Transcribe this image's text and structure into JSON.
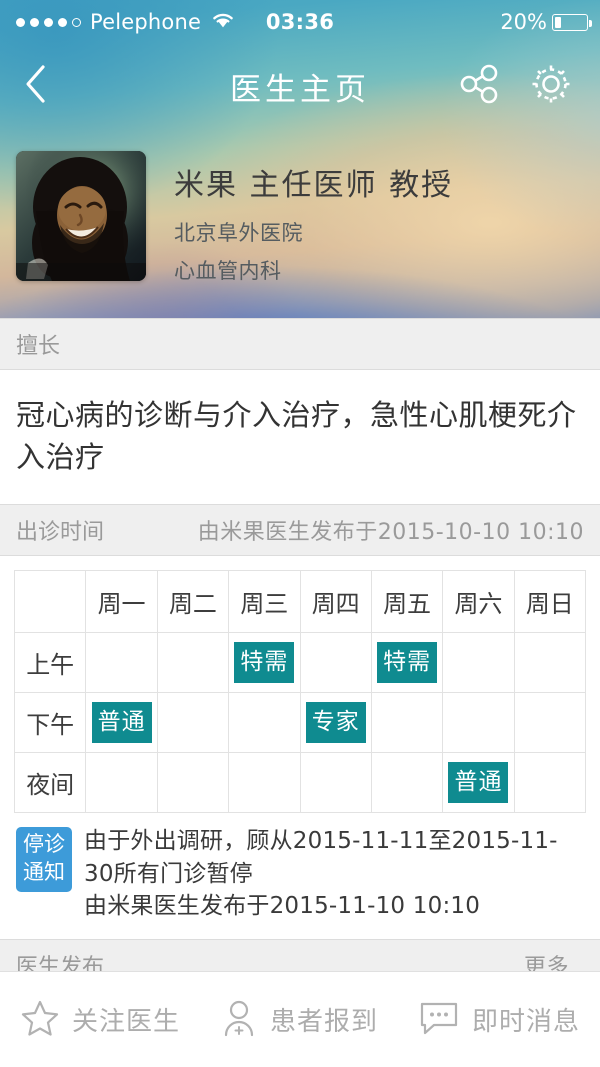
{
  "status_bar": {
    "signal_dots_filled": 4,
    "signal_dots_total": 5,
    "carrier": "Pelephone",
    "wifi_icon": "wifi-icon",
    "time": "03:36",
    "battery_percent": "20%"
  },
  "nav": {
    "back_icon": "chevron-left-icon",
    "title": "医生主页",
    "share_icon": "share-icon",
    "settings_icon": "gear-icon"
  },
  "doctor": {
    "avatar_alt": "doctor-avatar",
    "name_title": "米果 主任医师 教授",
    "hospital": "北京阜外医院",
    "department": "心血管内科",
    "chevron_icon": "chevron-right-icon"
  },
  "specialty_section": {
    "header": "擅长",
    "content": "冠心病的诊断与介入治疗，急性心肌梗死介入治疗"
  },
  "schedule_section": {
    "header": "出诊时间",
    "published_by": "由米果医生发布于2015-10-10 10:10",
    "columns": [
      "",
      "周一",
      "周二",
      "周三",
      "周四",
      "周五",
      "周六",
      "周日"
    ],
    "rows": [
      {
        "label": "上午",
        "cells": [
          "",
          "",
          "特需",
          "",
          "特需",
          "",
          ""
        ]
      },
      {
        "label": "下午",
        "cells": [
          "普通",
          "",
          "",
          "专家",
          "",
          "",
          ""
        ]
      },
      {
        "label": "夜间",
        "cells": [
          "",
          "",
          "",
          "",
          "",
          "普通",
          ""
        ]
      }
    ],
    "chip_color": "#0f8b90"
  },
  "notice": {
    "badge_line1": "停诊",
    "badge_line2": "通知",
    "badge_color": "#3d9bd9",
    "line1": "由于外出调研，顾从2015-11-11至2015-11-30所有门诊暂停",
    "line2": "由米果医生发布于2015-11-10 10:10"
  },
  "publish_section": {
    "header": "医生发布",
    "more": "更多.."
  },
  "bottom_bar": {
    "items": [
      {
        "icon": "star-icon",
        "label": "关注医生"
      },
      {
        "icon": "person-check-icon",
        "label": "患者报到"
      },
      {
        "icon": "chat-bubble-icon",
        "label": "即时消息"
      }
    ]
  }
}
